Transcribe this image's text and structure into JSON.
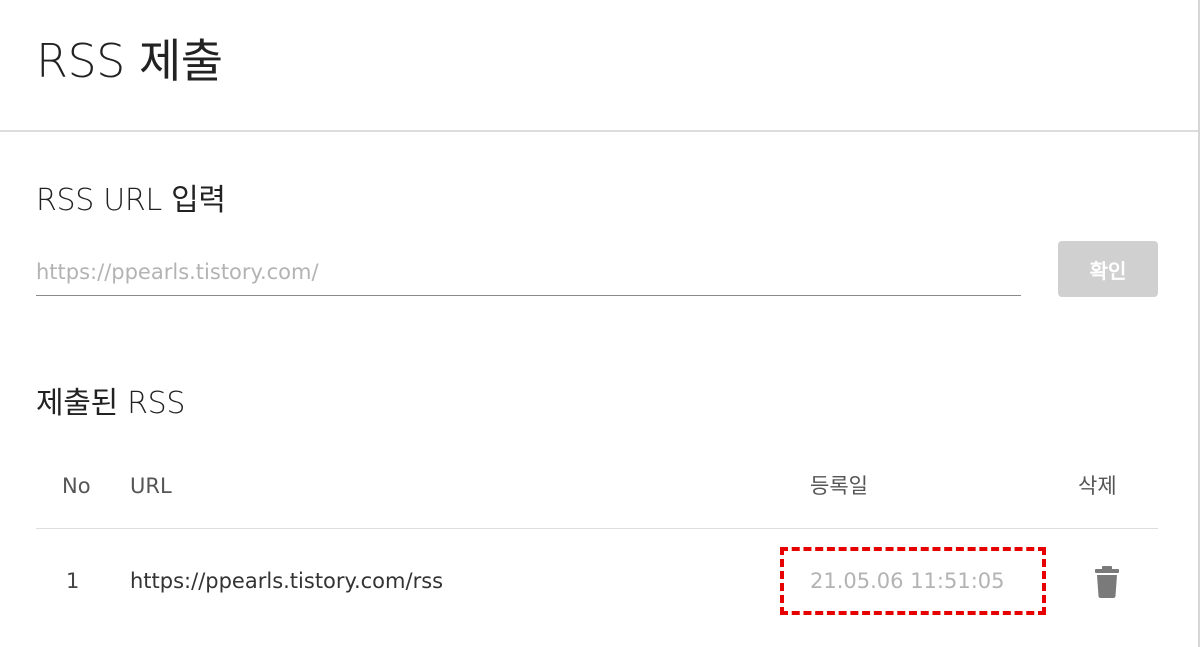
{
  "header": {
    "title": "RSS 제출"
  },
  "input_section": {
    "title": "RSS URL 입력",
    "url_field": {
      "value": "",
      "placeholder": "https://ppearls.tistory.com/"
    },
    "confirm_label": "확인"
  },
  "list_section": {
    "title": "제출된 RSS",
    "columns": {
      "no": "No",
      "url": "URL",
      "date": "등록일",
      "delete": "삭제"
    },
    "rows": [
      {
        "no": "1",
        "url": "https://ppearls.tistory.com/rss",
        "date": "21.05.06 11:51:05",
        "delete_icon": "trash-icon"
      }
    ]
  },
  "colors": {
    "button_disabled": "#d0d0d0",
    "highlight": "#e60000",
    "muted_text": "#b3b3b3"
  }
}
